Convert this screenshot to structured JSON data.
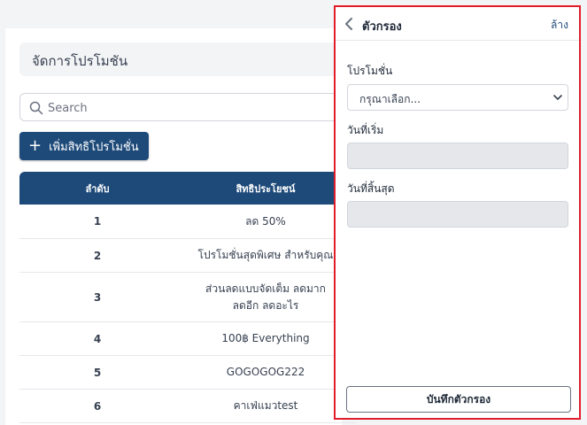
{
  "main": {
    "title": "จัดการโปรโมชัน",
    "search_placeholder": "Search",
    "add_button_label": "เพิ่มสิทธิโปรโมชั่น",
    "table": {
      "headers": [
        "ลำดับ",
        "สิทธิประโยชน์"
      ],
      "rows": [
        {
          "no": "1",
          "benefit": "ลด 50%"
        },
        {
          "no": "2",
          "benefit": "โปรโมชั่นสุดพิเศษ สำหรับคุณ"
        },
        {
          "no": "3",
          "benefit": "ส่วนลดแบบจัดเต็ม ลดมาก ลดอีก ลดอะไร"
        },
        {
          "no": "4",
          "benefit": "100฿ Everything"
        },
        {
          "no": "5",
          "benefit": "GOGOGOG222"
        },
        {
          "no": "6",
          "benefit": "คาเฟ่แมวtest"
        }
      ]
    }
  },
  "filter_panel": {
    "title": "ตัวกรอง",
    "clear_label": "ล้าง",
    "promotion_label": "โปรโมชั่น",
    "promotion_value": "กรุณาเลือก...",
    "start_date_label": "วันที่เริ่ม",
    "end_date_label": "วันที่สิ้นสุด",
    "save_label": "บันทึกตัวกรอง"
  },
  "colors": {
    "primary": "#1e4a7a",
    "highlight_border": "#e11d2c"
  }
}
